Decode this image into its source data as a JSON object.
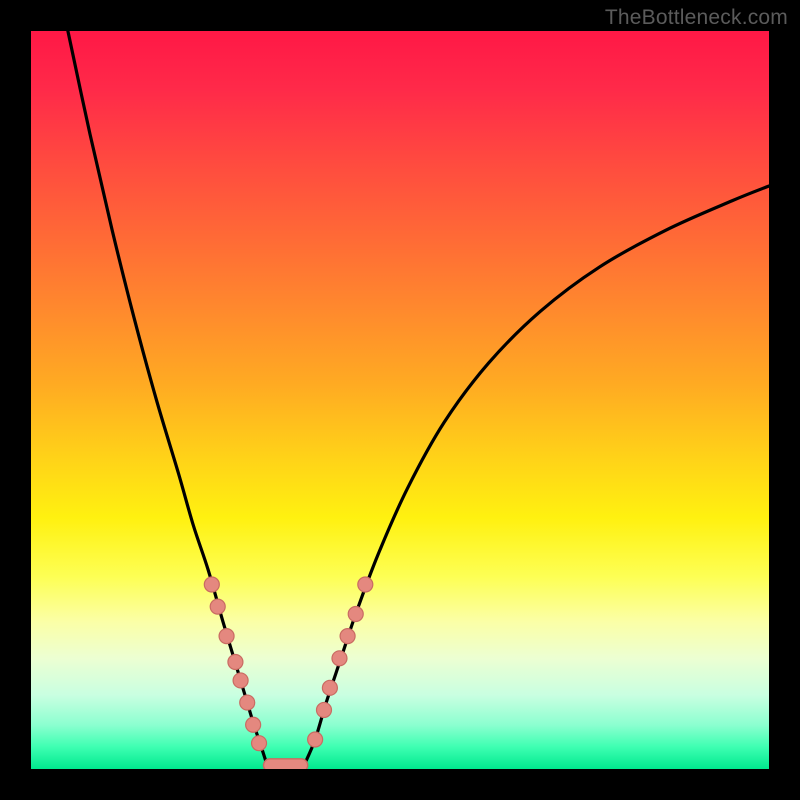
{
  "watermark": "TheBottleneck.com",
  "colors": {
    "curve": "#000000",
    "marker_fill": "#e4887f",
    "marker_stroke": "#c96b62",
    "plateau_fill": "#e4887f",
    "plateau_stroke": "#c96b62"
  },
  "chart_data": {
    "type": "line",
    "title": "",
    "xlabel": "",
    "ylabel": "",
    "xlim": [
      0,
      100
    ],
    "ylim": [
      0,
      100
    ],
    "series": [
      {
        "name": "left-branch",
        "x": [
          5,
          8,
          11,
          14,
          17,
          20,
          22,
          24,
          26,
          27.5,
          29,
          30.2,
          31.2,
          32
        ],
        "y": [
          100,
          86,
          73,
          61,
          50,
          40,
          33,
          27,
          20,
          15,
          10,
          6,
          3,
          0.5
        ]
      },
      {
        "name": "right-branch",
        "x": [
          37,
          38.5,
          40,
          42,
          44,
          47,
          51,
          56,
          62,
          69,
          77,
          86,
          95,
          100
        ],
        "y": [
          0.5,
          4,
          9,
          15,
          21,
          29,
          38,
          47,
          55,
          62,
          68,
          73,
          77,
          79
        ]
      },
      {
        "name": "plateau",
        "x": [
          31.5,
          37.5
        ],
        "y": [
          0.5,
          0.5
        ]
      }
    ],
    "markers": {
      "left": [
        {
          "x": 24.5,
          "y": 25
        },
        {
          "x": 25.3,
          "y": 22
        },
        {
          "x": 26.5,
          "y": 18
        },
        {
          "x": 27.7,
          "y": 14.5
        },
        {
          "x": 28.4,
          "y": 12
        },
        {
          "x": 29.3,
          "y": 9
        },
        {
          "x": 30.1,
          "y": 6
        },
        {
          "x": 30.9,
          "y": 3.5
        }
      ],
      "right": [
        {
          "x": 38.5,
          "y": 4
        },
        {
          "x": 39.7,
          "y": 8
        },
        {
          "x": 40.5,
          "y": 11
        },
        {
          "x": 41.8,
          "y": 15
        },
        {
          "x": 42.9,
          "y": 18
        },
        {
          "x": 44.0,
          "y": 21
        },
        {
          "x": 45.3,
          "y": 25
        }
      ]
    }
  }
}
